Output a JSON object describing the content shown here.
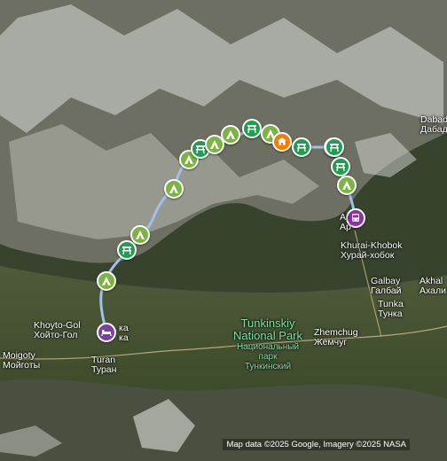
{
  "map": {
    "attribution": "Map data ©2025 Google, Imagery ©2025 NASA",
    "colors": {
      "route": "#9ec1ee",
      "campsite": "#7cb342",
      "picnic": "#1e9e4f",
      "lodging": "#7b3fa8",
      "bus": "#8d2fa8",
      "shelter": "#f57c00",
      "park_label": "#7fe3a8"
    },
    "places": [
      {
        "id": "dabad",
        "lines": [
          "Dabad",
          "Дабад"
        ]
      },
      {
        "id": "khurai-khobok",
        "lines": [
          "Khurai-Khobok",
          "Хурай-хобок"
        ]
      },
      {
        "id": "arshan",
        "lines": [
          "Ar",
          "Ар"
        ]
      },
      {
        "id": "galbay",
        "lines": [
          "Galbay",
          "Галбай"
        ]
      },
      {
        "id": "akhali",
        "lines": [
          "Akhal",
          "Ахали"
        ]
      },
      {
        "id": "tunka",
        "lines": [
          "Tunka",
          "Тунка"
        ]
      },
      {
        "id": "zhemchug",
        "lines": [
          "Zhemchug",
          "Жемчуг"
        ]
      },
      {
        "id": "khoyto-gol",
        "lines": [
          "Khoyto-Gol",
          "Хойто-Гол"
        ]
      },
      {
        "id": "nilovka",
        "lines": [
          "ка",
          "ка"
        ]
      },
      {
        "id": "moigoty",
        "lines": [
          "Moigoty",
          "Мойготы"
        ]
      },
      {
        "id": "turan",
        "lines": [
          "Turan",
          "Туран"
        ]
      }
    ],
    "park": {
      "lines_en": [
        "Tunkinskiy",
        "National Park"
      ],
      "lines_ru": [
        "Национальный",
        "парк",
        "Тункинский"
      ]
    },
    "markers": [
      {
        "type": "campsite",
        "icon": "tent"
      },
      {
        "type": "picnic",
        "icon": "picnic-table"
      },
      {
        "type": "campsite",
        "icon": "tent"
      },
      {
        "type": "campsite",
        "icon": "tent"
      },
      {
        "type": "campsite",
        "icon": "tent"
      },
      {
        "type": "picnic",
        "icon": "picnic-table"
      },
      {
        "type": "campsite",
        "icon": "tent"
      },
      {
        "type": "campsite",
        "icon": "tent"
      },
      {
        "type": "picnic",
        "icon": "picnic-table"
      },
      {
        "type": "campsite",
        "icon": "tent"
      },
      {
        "type": "picnic",
        "icon": "picnic-table"
      },
      {
        "type": "shelter",
        "icon": "shelter"
      },
      {
        "type": "picnic",
        "icon": "picnic-table"
      },
      {
        "type": "campsite",
        "icon": "tent"
      },
      {
        "type": "picnic",
        "icon": "picnic-table"
      },
      {
        "type": "campsite",
        "icon": "tent"
      },
      {
        "type": "bus",
        "icon": "bus"
      },
      {
        "type": "lodging",
        "icon": "bed"
      }
    ]
  }
}
